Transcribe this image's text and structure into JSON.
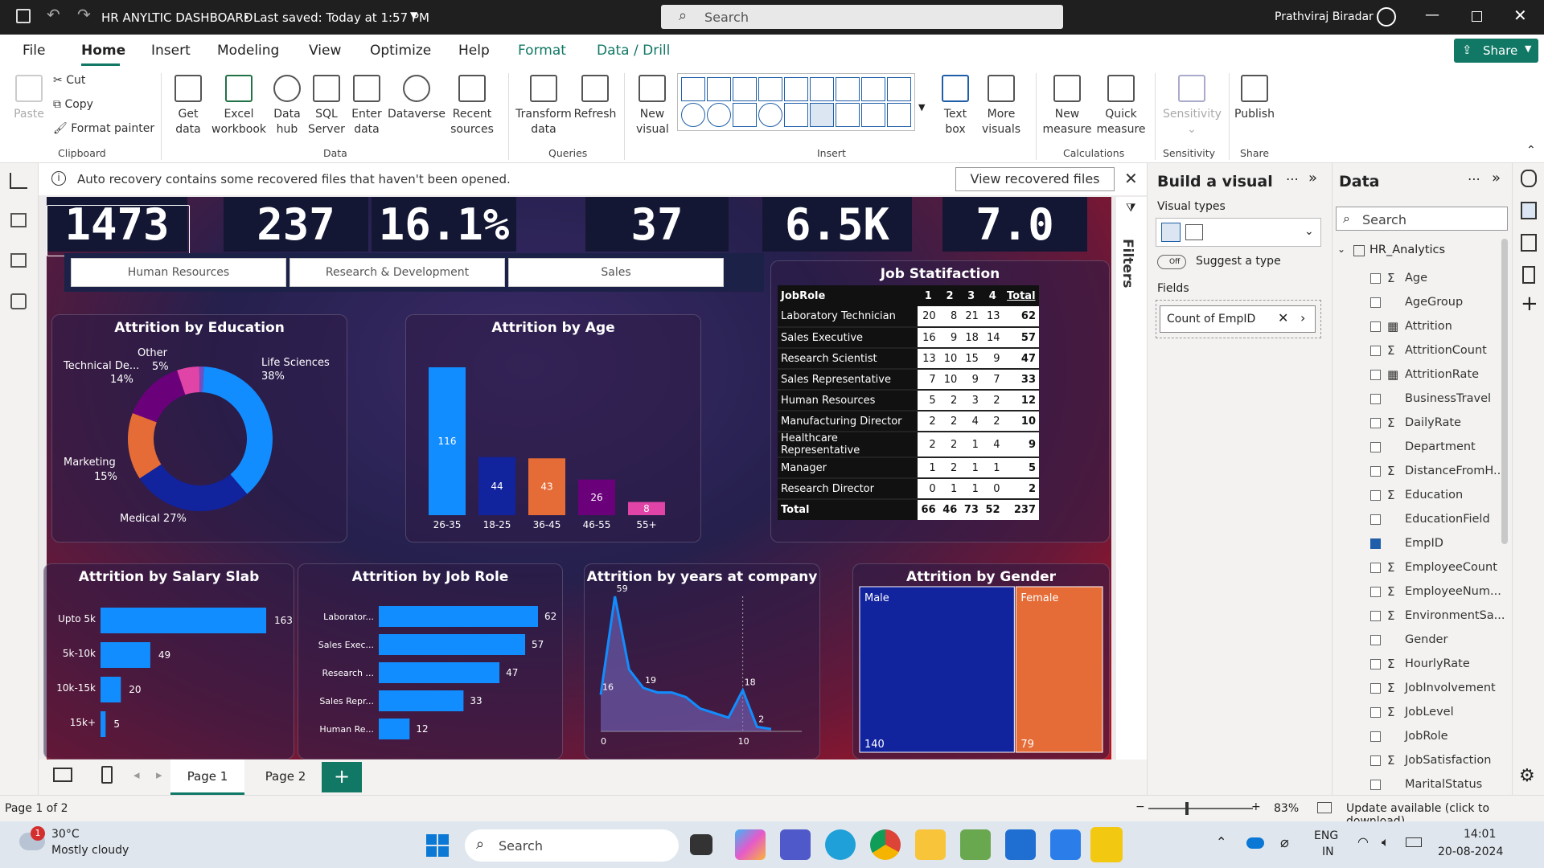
{
  "titlebar": {
    "doc_title": "HR ANYLTIC DASHBOARD",
    "saved": "Last saved: Today at 1:57 PM",
    "search_placeholder": "Search",
    "user": "Prathviraj Biradar"
  },
  "menu": [
    "File",
    "Home",
    "Insert",
    "Modeling",
    "View",
    "Optimize",
    "Help",
    "Format",
    "Data / Drill"
  ],
  "share_label": "Share",
  "ribbon": {
    "paste": "Paste",
    "cut": "Cut",
    "copy": "Copy",
    "format_painter": "Format painter",
    "clipboard": "Clipboard",
    "get_data": "Get data",
    "excel": "Excel workbook",
    "data_hub": "Data hub",
    "sql": "SQL Server",
    "enter_data": "Enter data",
    "dataverse": "Dataverse",
    "recent": "Recent sources",
    "data": "Data",
    "transform": "Transform data",
    "refresh": "Refresh",
    "queries": "Queries",
    "new_visual": "New visual",
    "text_box": "Text box",
    "more_visuals": "More visuals",
    "insert": "Insert",
    "new_measure": "New measure",
    "quick_measure": "Quick measure",
    "calculations": "Calculations",
    "sensitivity": "Sensitivity",
    "sensitivity_group": "Sensitivity",
    "publish": "Publish",
    "share_group": "Share"
  },
  "infobar": {
    "message": "Auto recovery contains some recovered files that haven't been opened.",
    "button": "View recovered files"
  },
  "filters_label": "Filters",
  "kpis": [
    "1473",
    "237",
    "16.1%",
    "37",
    "6.5K",
    "7.0"
  ],
  "slicer": [
    "Human Resources",
    "Research & Development",
    "Sales"
  ],
  "education_chart": {
    "title": "Attrition by Education",
    "labels": [
      {
        "name": "Life Sciences",
        "pct": "38%"
      },
      {
        "name": "Medical 27%",
        "pct": ""
      },
      {
        "name": "Marketing",
        "pct": "15%"
      },
      {
        "name": "Technical De...",
        "pct": "14%"
      },
      {
        "name": "Other",
        "pct": "5%"
      }
    ]
  },
  "age_chart": {
    "title": "Attrition by Age"
  },
  "job_sat": {
    "title": "Job Statifaction",
    "headers": [
      "JobRole",
      "1",
      "2",
      "3",
      "4",
      "Total"
    ],
    "rows": [
      [
        "Laboratory Technician",
        "20",
        "8",
        "21",
        "13",
        "62"
      ],
      [
        "Sales Executive",
        "16",
        "9",
        "18",
        "14",
        "57"
      ],
      [
        "Research Scientist",
        "13",
        "10",
        "15",
        "9",
        "47"
      ],
      [
        "Sales Representative",
        "7",
        "10",
        "9",
        "7",
        "33"
      ],
      [
        "Human Resources",
        "5",
        "2",
        "3",
        "2",
        "12"
      ],
      [
        "Manufacturing Director",
        "2",
        "2",
        "4",
        "2",
        "10"
      ],
      [
        "Healthcare Representative",
        "2",
        "2",
        "1",
        "4",
        "9"
      ],
      [
        "Manager",
        "1",
        "2",
        "1",
        "1",
        "5"
      ],
      [
        "Research Director",
        "0",
        "1",
        "1",
        "0",
        "2"
      ]
    ],
    "total": [
      "Total",
      "66",
      "46",
      "73",
      "52",
      "237"
    ]
  },
  "salary_chart": {
    "title": "Attrition by Salary Slab"
  },
  "jobrole_chart": {
    "title": "Attrition by Job Role"
  },
  "years_chart": {
    "title": "Attrition by years at company"
  },
  "gender_chart": {
    "title": "Attrition by Gender"
  },
  "chart_data": [
    {
      "type": "pie",
      "title": "Attrition by Education",
      "categories": [
        "Life Sciences",
        "Medical",
        "Marketing",
        "Technical Degree",
        "Other",
        "Human Resources"
      ],
      "values": [
        38,
        27,
        15,
        14,
        5,
        1
      ],
      "colors": [
        "#118dff",
        "#12239e",
        "#e66c37",
        "#6b007b",
        "#e044a7",
        "#744ec2"
      ]
    },
    {
      "type": "bar",
      "title": "Attrition by Age",
      "categories": [
        "26-35",
        "18-25",
        "36-45",
        "46-55",
        "55+"
      ],
      "values": [
        116,
        44,
        43,
        26,
        8
      ],
      "colors": [
        "#118dff",
        "#12239e",
        "#e66c37",
        "#6b007b",
        "#e044a7"
      ]
    },
    {
      "type": "bar",
      "title": "Attrition by Salary Slab",
      "orientation": "horizontal",
      "categories": [
        "Upto 5k",
        "5k-10k",
        "10k-15k",
        "15k+"
      ],
      "values": [
        163,
        49,
        20,
        5
      ]
    },
    {
      "type": "bar",
      "title": "Attrition by Job Role",
      "orientation": "horizontal",
      "categories": [
        "Laborator...",
        "Sales Exec...",
        "Research ...",
        "Sales Repr...",
        "Human Re..."
      ],
      "values": [
        62,
        57,
        47,
        33,
        12
      ]
    },
    {
      "type": "area",
      "title": "Attrition by years at company",
      "x": [
        0,
        1,
        2,
        3,
        4,
        5,
        6,
        7,
        8,
        9,
        10,
        11,
        12
      ],
      "values": [
        16,
        59,
        27,
        19,
        17,
        17,
        15,
        10,
        8,
        6,
        18,
        2,
        1
      ],
      "x_ticks": [
        "0",
        "10"
      ],
      "labels": {
        "0": "16",
        "1": "59",
        "3": "19",
        "10": "18",
        "11": "2"
      }
    },
    {
      "type": "treemap",
      "title": "Attrition by Gender",
      "categories": [
        "Male",
        "Female"
      ],
      "values": [
        140,
        79
      ],
      "colors": [
        "#12239e",
        "#e66c37"
      ]
    }
  ],
  "visual_types_label": "Visual types",
  "suggest_label": "Suggest a type",
  "toggle_off": "Off",
  "build_title": "Build a visual",
  "fields_label": "Fields",
  "field_well": "Count of EmpID",
  "data_pane": {
    "title": "Data",
    "search_placeholder": "Search",
    "table": "HR_Analytics",
    "fields": [
      {
        "n": "Age",
        "s": "Σ",
        "c": false
      },
      {
        "n": "AgeGroup",
        "s": "",
        "c": false
      },
      {
        "n": "Attrition",
        "s": "▦",
        "c": false
      },
      {
        "n": "AttritionCount",
        "s": "Σ",
        "c": false
      },
      {
        "n": "AttritionRate",
        "s": "▦",
        "c": false
      },
      {
        "n": "BusinessTravel",
        "s": "",
        "c": false
      },
      {
        "n": "DailyRate",
        "s": "Σ",
        "c": false
      },
      {
        "n": "Department",
        "s": "",
        "c": false
      },
      {
        "n": "DistanceFromH...",
        "s": "Σ",
        "c": false
      },
      {
        "n": "Education",
        "s": "Σ",
        "c": false
      },
      {
        "n": "EducationField",
        "s": "",
        "c": false
      },
      {
        "n": "EmpID",
        "s": "",
        "c": true
      },
      {
        "n": "EmployeeCount",
        "s": "Σ",
        "c": false
      },
      {
        "n": "EmployeeNum...",
        "s": "Σ",
        "c": false
      },
      {
        "n": "EnvironmentSa...",
        "s": "Σ",
        "c": false
      },
      {
        "n": "Gender",
        "s": "",
        "c": false
      },
      {
        "n": "HourlyRate",
        "s": "Σ",
        "c": false
      },
      {
        "n": "JobInvolvement",
        "s": "Σ",
        "c": false
      },
      {
        "n": "JobLevel",
        "s": "Σ",
        "c": false
      },
      {
        "n": "JobRole",
        "s": "",
        "c": false
      },
      {
        "n": "JobSatisfaction",
        "s": "Σ",
        "c": false
      },
      {
        "n": "MaritalStatus",
        "s": "",
        "c": false
      }
    ]
  },
  "pages": [
    "Page 1",
    "Page 2"
  ],
  "status": {
    "page": "Page 1 of 2",
    "zoom": "83%",
    "update": "Update available (click to download)"
  },
  "taskbar": {
    "temp": "30°C",
    "weather": "Mostly cloudy",
    "search": "Search",
    "lang1": "ENG",
    "lang2": "IN",
    "time": "14:01",
    "date": "20-08-2024",
    "badge": "1"
  }
}
